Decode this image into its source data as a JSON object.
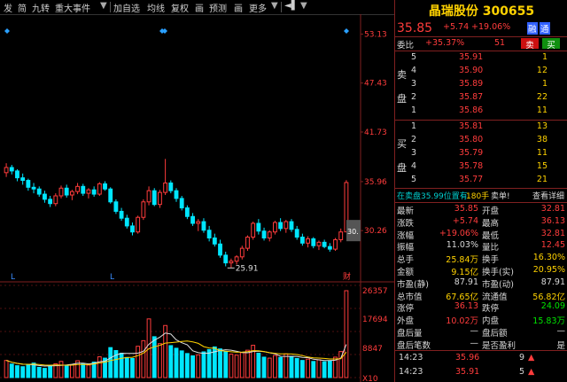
{
  "toolbar": {
    "items": [
      "发",
      "简",
      "九转",
      "重大事件",
      "加自选",
      "均线",
      "复权",
      "画",
      "预测",
      "画",
      "更多"
    ]
  },
  "stock": {
    "name": "晶瑞股份",
    "code": "300655"
  },
  "quote": {
    "price": "35.85",
    "change": "+5.74",
    "pct": "+19.06%",
    "badge": "融",
    "badge2": "通"
  },
  "weibi": {
    "label": "委比",
    "pct": "+35.37%",
    "diff": "51"
  },
  "sell": {
    "label1": "卖",
    "label2": "盘",
    "rows": [
      {
        "lvl": "5",
        "price": "35.91",
        "vol": "1"
      },
      {
        "lvl": "4",
        "price": "35.90",
        "vol": "12"
      },
      {
        "lvl": "3",
        "price": "35.89",
        "vol": "1"
      },
      {
        "lvl": "2",
        "price": "35.87",
        "vol": "22"
      },
      {
        "lvl": "1",
        "price": "35.86",
        "vol": "11"
      }
    ]
  },
  "buy": {
    "label1": "买",
    "label2": "盘",
    "rows": [
      {
        "lvl": "1",
        "price": "35.81",
        "vol": "13"
      },
      {
        "lvl": "2",
        "price": "35.80",
        "vol": "38"
      },
      {
        "lvl": "3",
        "price": "35.79",
        "vol": "11"
      },
      {
        "lvl": "4",
        "price": "35.78",
        "vol": "15"
      },
      {
        "lvl": "5",
        "price": "35.77",
        "vol": "21"
      }
    ]
  },
  "notice": {
    "text1": "在卖盘35.99位置有",
    "num": "180手",
    "text2": "卖单!",
    "link": "查看详细"
  },
  "stats": [
    {
      "l": "最新",
      "v": "35.85",
      "vc": "red",
      "l2": "开盘",
      "v2": "32.81",
      "v2c": "red"
    },
    {
      "l": "涨跌",
      "v": "+5.74",
      "vc": "red",
      "l2": "最高",
      "v2": "36.13",
      "v2c": "red"
    },
    {
      "l": "涨幅",
      "v": "+19.06%",
      "vc": "red",
      "l2": "最低",
      "v2": "32.81",
      "v2c": "red"
    },
    {
      "l": "振幅",
      "v": "11.03%",
      "vc": "white",
      "l2": "量比",
      "v2": "12.45",
      "v2c": "red"
    },
    {
      "l": "总手",
      "v": "25.84万",
      "vc": "yellow",
      "l2": "换手",
      "v2": "16.30%",
      "v2c": "yellow"
    },
    {
      "l": "金额",
      "v": "9.15亿",
      "vc": "yellow",
      "l2": "换手(实)",
      "v2": "20.95%",
      "v2c": "yellow"
    },
    {
      "l": "市盈(静)",
      "v": "87.91",
      "vc": "white",
      "l2": "市盈(动)",
      "v2": "87.91",
      "v2c": "white"
    },
    {
      "l": "总市值",
      "v": "67.65亿",
      "vc": "yellow",
      "l2": "流通值",
      "v2": "56.82亿",
      "v2c": "yellow"
    },
    {
      "l": "涨停",
      "v": "36.13",
      "vc": "red",
      "l2": "跌停",
      "v2": "24.09",
      "v2c": "green"
    },
    {
      "l": "外盘",
      "v": "10.02万",
      "vc": "red",
      "l2": "内盘",
      "v2": "15.83万",
      "v2c": "green"
    },
    {
      "l": "盘后量",
      "v": "—",
      "vc": "white",
      "l2": "盘后额",
      "v2": "—",
      "v2c": "white"
    },
    {
      "l": "盘后笔数",
      "v": "—",
      "vc": "white",
      "l2": "是否盈利",
      "v2": "是",
      "v2c": "white"
    }
  ],
  "ticks": [
    {
      "time": "14:23",
      "price": "35.96",
      "vol": "9"
    },
    {
      "time": "14:23",
      "price": "35.91",
      "vol": "5"
    }
  ],
  "axis": {
    "price_labels": [
      "53.13",
      "47.43",
      "41.73",
      "35.96",
      "30.26"
    ],
    "last_tag": "30.",
    "min_label": "25.91",
    "vol_labels": [
      "26357",
      "17694",
      "8847",
      "X10"
    ],
    "marker_l": "L",
    "marker_cai": "财"
  },
  "colors": {
    "up": "#ff3c3c",
    "down": "#00e6ff",
    "ma5": "#e0e0e0",
    "ma10": "#ffd200",
    "bg": "#000000"
  },
  "chart_data": {
    "type": "candlestick",
    "candles": [
      [
        37.0,
        38.1,
        36.5,
        37.6
      ],
      [
        37.6,
        37.9,
        36.8,
        37.2
      ],
      [
        37.2,
        37.4,
        36.0,
        36.4
      ],
      [
        36.4,
        36.9,
        35.6,
        36.1
      ],
      [
        36.1,
        36.3,
        34.9,
        35.3
      ],
      [
        35.3,
        35.8,
        34.6,
        35.1
      ],
      [
        35.1,
        35.4,
        34.2,
        34.5
      ],
      [
        34.5,
        34.9,
        33.5,
        33.9
      ],
      [
        33.9,
        34.3,
        33.0,
        33.4
      ],
      [
        33.4,
        34.6,
        33.1,
        34.3
      ],
      [
        34.3,
        35.5,
        34.0,
        35.2
      ],
      [
        35.2,
        35.6,
        34.1,
        34.4
      ],
      [
        34.4,
        35.0,
        33.8,
        34.8
      ],
      [
        34.8,
        35.8,
        34.5,
        35.4
      ],
      [
        35.4,
        35.7,
        34.3,
        34.6
      ],
      [
        34.6,
        35.2,
        34.0,
        35.0
      ],
      [
        35.0,
        35.4,
        34.2,
        34.5
      ],
      [
        34.5,
        35.9,
        34.3,
        35.7
      ],
      [
        35.7,
        36.0,
        34.9,
        35.1
      ],
      [
        35.1,
        35.3,
        33.4,
        33.6
      ],
      [
        33.6,
        33.9,
        32.2,
        32.5
      ],
      [
        32.5,
        32.9,
        31.4,
        31.7
      ],
      [
        31.7,
        32.1,
        30.5,
        30.8
      ],
      [
        30.8,
        31.2,
        29.7,
        30.1
      ],
      [
        30.1,
        32.0,
        29.9,
        31.8
      ],
      [
        31.8,
        33.9,
        31.5,
        33.6
      ],
      [
        33.6,
        35.4,
        33.2,
        34.9
      ],
      [
        34.9,
        35.2,
        33.1,
        33.3
      ],
      [
        33.3,
        35.0,
        32.9,
        34.7
      ],
      [
        34.7,
        38.6,
        34.4,
        35.8
      ],
      [
        35.8,
        36.1,
        34.6,
        34.9
      ],
      [
        34.9,
        35.2,
        33.6,
        34.0
      ],
      [
        34.0,
        34.3,
        32.6,
        32.9
      ],
      [
        32.9,
        33.2,
        31.6,
        31.9
      ],
      [
        31.9,
        32.3,
        30.8,
        31.1
      ],
      [
        31.1,
        31.6,
        30.2,
        31.3
      ],
      [
        31.3,
        31.7,
        30.0,
        30.3
      ],
      [
        30.3,
        30.8,
        29.0,
        29.4
      ],
      [
        29.4,
        29.9,
        28.4,
        28.7
      ],
      [
        28.7,
        29.2,
        27.1,
        27.4
      ],
      [
        27.4,
        27.8,
        26.1,
        26.5
      ],
      [
        26.5,
        27.0,
        25.9,
        26.7
      ],
      [
        26.7,
        27.4,
        26.3,
        27.2
      ],
      [
        27.2,
        28.5,
        26.9,
        28.2
      ],
      [
        28.2,
        29.7,
        27.9,
        29.5
      ],
      [
        29.5,
        31.3,
        29.2,
        31.1
      ],
      [
        31.1,
        31.6,
        29.8,
        30.2
      ],
      [
        30.2,
        30.6,
        29.1,
        29.4
      ],
      [
        29.4,
        30.3,
        29.0,
        30.1
      ],
      [
        30.1,
        31.4,
        29.8,
        31.2
      ],
      [
        31.2,
        31.7,
        30.2,
        30.5
      ],
      [
        30.5,
        31.5,
        30.0,
        31.3
      ],
      [
        31.3,
        31.6,
        30.1,
        30.4
      ],
      [
        30.4,
        30.8,
        29.2,
        29.5
      ],
      [
        29.5,
        29.9,
        28.5,
        28.8
      ],
      [
        28.8,
        29.6,
        28.3,
        29.3
      ],
      [
        29.3,
        29.5,
        28.2,
        28.5
      ],
      [
        28.5,
        29.1,
        28.0,
        28.9
      ],
      [
        28.9,
        29.2,
        28.2,
        28.4
      ],
      [
        28.4,
        28.8,
        27.8,
        28.1
      ],
      [
        28.1,
        29.4,
        27.9,
        29.2
      ],
      [
        29.2,
        30.5,
        28.9,
        30.1
      ],
      [
        30.11,
        36.13,
        30.11,
        35.85
      ]
    ],
    "volumes": [
      5200,
      4100,
      3600,
      3300,
      3900,
      4400,
      3100,
      2800,
      3500,
      4200,
      4900,
      3700,
      3900,
      5100,
      4200,
      3800,
      4700,
      6300,
      5900,
      9100,
      8200,
      7400,
      6100,
      5800,
      9500,
      11200,
      17800,
      12400,
      10300,
      15800,
      9700,
      8900,
      8100,
      7300,
      6600,
      6900,
      7800,
      8500,
      9300,
      8700,
      7900,
      7100,
      6800,
      7600,
      8300,
      9800,
      7400,
      6200,
      5900,
      6700,
      6100,
      7200,
      6400,
      5800,
      5200,
      5600,
      4900,
      5400,
      4800,
      5100,
      6200,
      7900,
      26357
    ],
    "price_range": [
      24.5,
      54.0
    ],
    "volume_max": 26357
  }
}
